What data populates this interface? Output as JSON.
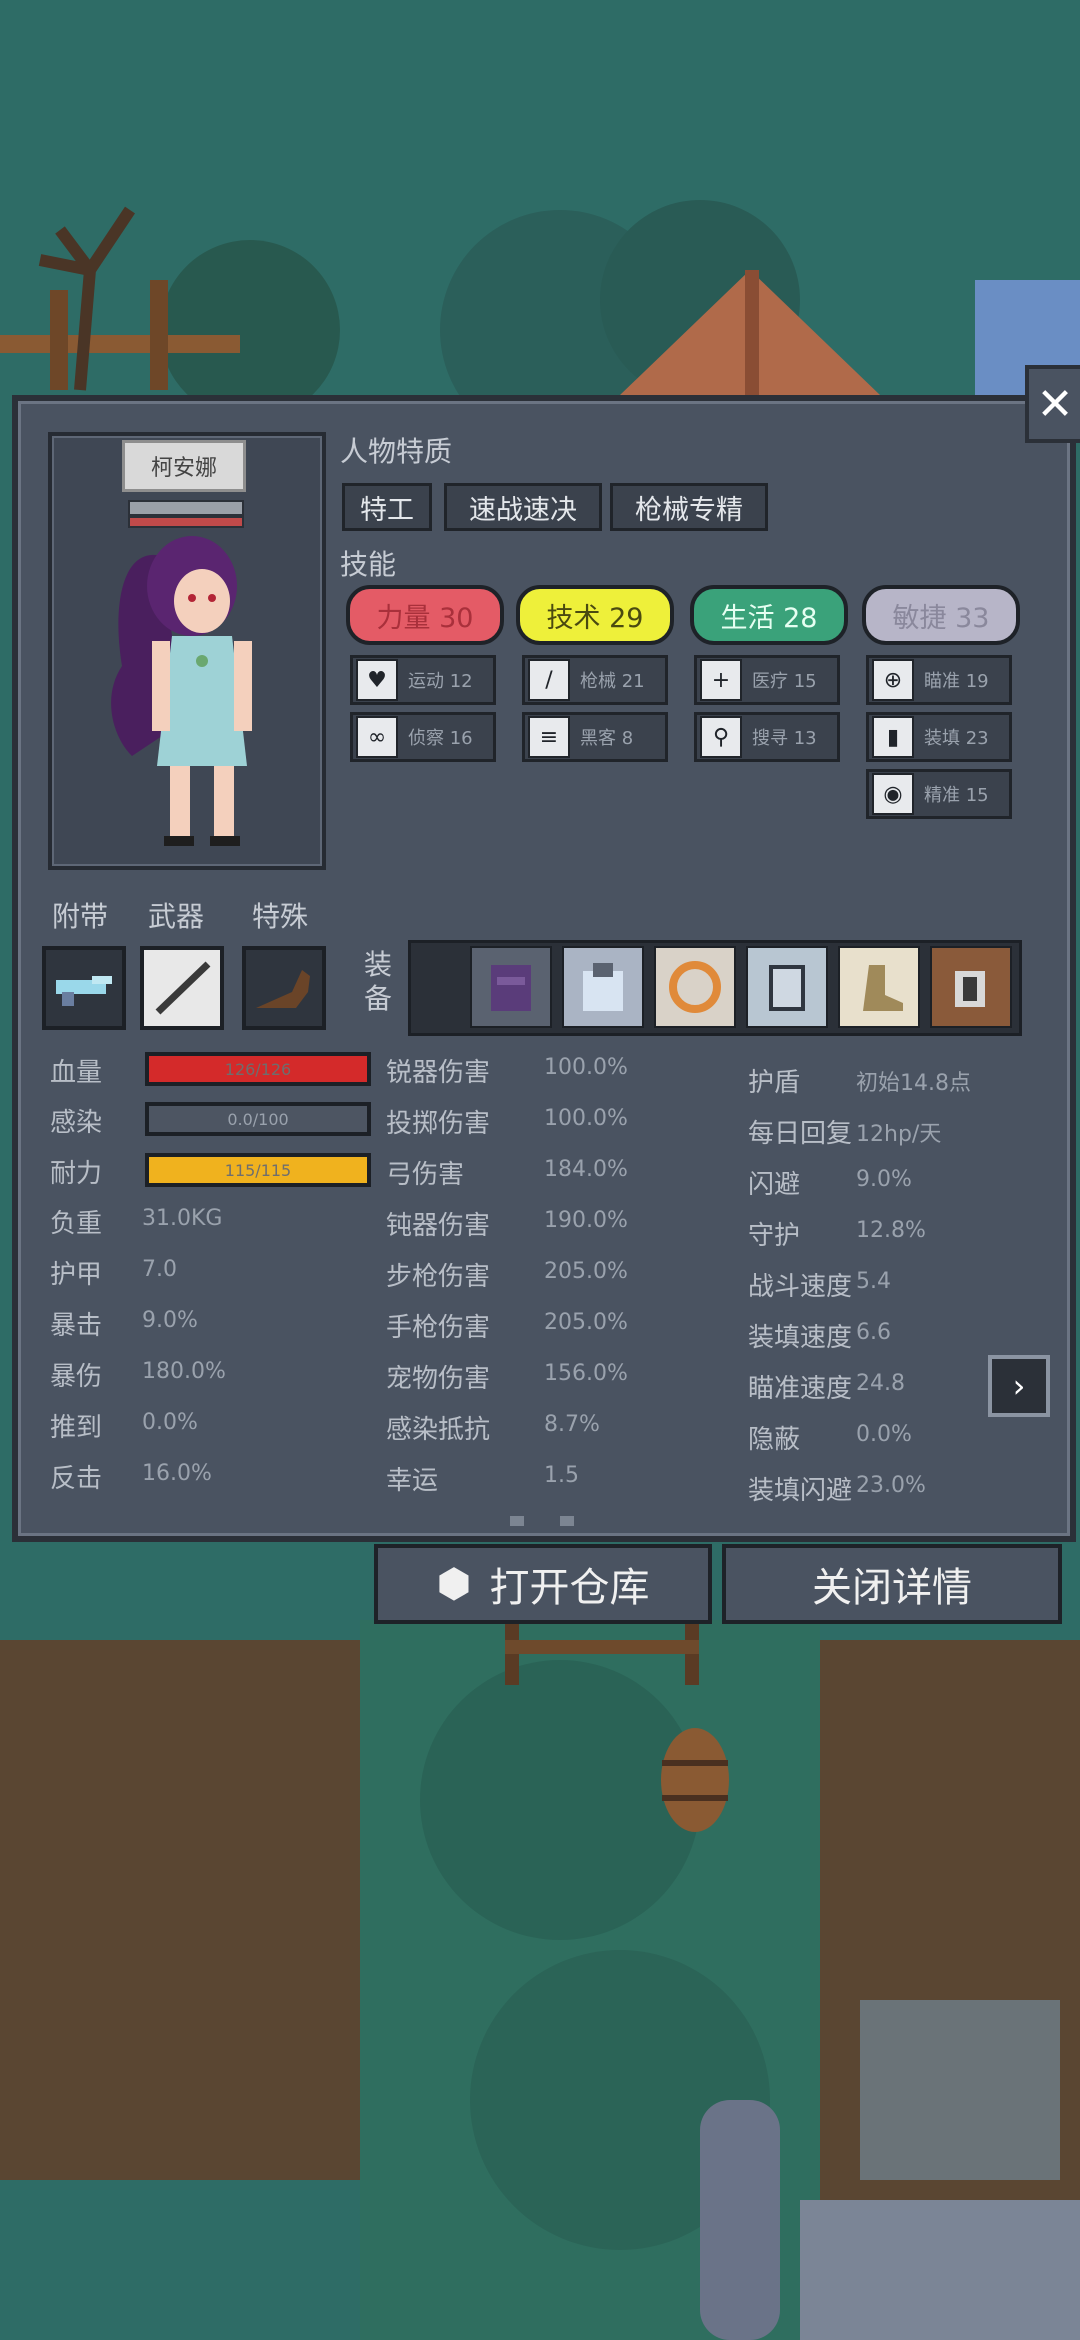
{
  "character": {
    "name": "柯安娜"
  },
  "traits_title": "人物特质",
  "traits": [
    "特工",
    "速战速决",
    "枪械专精"
  ],
  "skills_title": "技能",
  "skills": [
    {
      "label": "力量 30",
      "color": "#e45b66",
      "text_color": "#a9303b"
    },
    {
      "label": "技术 29",
      "color": "#eef03a",
      "text_color": "#4a4a10"
    },
    {
      "label": "生活 28",
      "color": "#3aa27a",
      "text_color": "#e6fff2"
    },
    {
      "label": "敏捷 33",
      "color": "#b7b5c8",
      "text_color": "#8a889c"
    }
  ],
  "sub_skills": [
    {
      "label": "运动 12",
      "icon": "heart-icon"
    },
    {
      "label": "枪械 21",
      "icon": "knife-icon"
    },
    {
      "label": "医疗 15",
      "icon": "medkit-icon"
    },
    {
      "label": "瞄准 19",
      "icon": "crosshair-icon"
    },
    {
      "label": "侦察 16",
      "icon": "goggles-icon"
    },
    {
      "label": "黑客 8",
      "icon": "circuit-icon"
    },
    {
      "label": "搜寻 13",
      "icon": "magnifier-icon"
    },
    {
      "label": "装填 23",
      "icon": "magazine-icon"
    },
    {
      "label": "精准 15",
      "icon": "eye-icon"
    }
  ],
  "slot_labels": {
    "accessory": "附带",
    "weapon": "武器",
    "special": "特殊",
    "equipment": "装备"
  },
  "bars": [
    {
      "name": "血量",
      "text": "126/126",
      "fill": 1.0,
      "color": "#d42a2a"
    },
    {
      "name": "感染",
      "text": "0.0/100",
      "fill": 0.0,
      "color": "#c0c0c0"
    },
    {
      "name": "耐力",
      "text": "115/115",
      "fill": 1.0,
      "color": "#f0b21e"
    }
  ],
  "stats_left": [
    {
      "name": "负重",
      "value": "31.0KG"
    },
    {
      "name": "护甲",
      "value": "7.0"
    },
    {
      "name": "暴击",
      "value": "9.0%"
    },
    {
      "name": "暴伤",
      "value": "180.0%"
    },
    {
      "name": "推到",
      "value": "0.0%"
    },
    {
      "name": "反击",
      "value": "16.0%"
    }
  ],
  "stats_mid": [
    {
      "name": "锐器伤害",
      "value": "100.0%"
    },
    {
      "name": "投掷伤害",
      "value": "100.0%"
    },
    {
      "name": "弓伤害",
      "value": "184.0%"
    },
    {
      "name": "钝器伤害",
      "value": "190.0%"
    },
    {
      "name": "步枪伤害",
      "value": "205.0%"
    },
    {
      "name": "手枪伤害",
      "value": "205.0%"
    },
    {
      "name": "宠物伤害",
      "value": "156.0%"
    },
    {
      "name": "感染抵抗",
      "value": "8.7%"
    },
    {
      "name": "幸运",
      "value": "1.5"
    }
  ],
  "stats_right": [
    {
      "name": "护盾",
      "value": "初始14.8点"
    },
    {
      "name": "每日回复",
      "value": "12hp/天"
    },
    {
      "name": "闪避",
      "value": "9.0%"
    },
    {
      "name": "守护",
      "value": "12.8%"
    },
    {
      "name": "战斗速度",
      "value": "5.4"
    },
    {
      "name": "装填速度",
      "value": "6.6"
    },
    {
      "name": "瞄准速度",
      "value": "24.8"
    },
    {
      "name": "隐蔽",
      "value": "0.0%"
    },
    {
      "name": "装填闪避",
      "value": "23.0%"
    }
  ],
  "buttons": {
    "open_storage": "打开仓库",
    "close_details": "关闭详情",
    "close": "✕",
    "next": "›"
  }
}
